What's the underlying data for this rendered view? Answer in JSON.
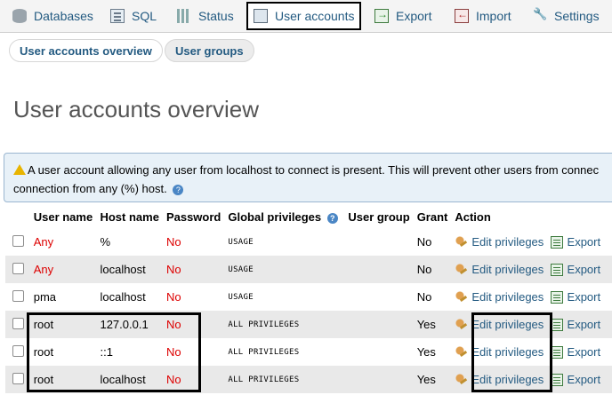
{
  "nav": {
    "tabs": [
      {
        "label": "Databases",
        "icon": "database-icon"
      },
      {
        "label": "SQL",
        "icon": "sql-icon"
      },
      {
        "label": "Status",
        "icon": "status-icon"
      },
      {
        "label": "User accounts",
        "icon": "user-accounts-icon",
        "active": true
      },
      {
        "label": "Export",
        "icon": "export-icon"
      },
      {
        "label": "Import",
        "icon": "import-icon"
      },
      {
        "label": "Settings",
        "icon": "wrench-icon"
      }
    ]
  },
  "subnav": {
    "overview": "User accounts overview",
    "groups": "User groups"
  },
  "page": {
    "title": "User accounts overview"
  },
  "notice": {
    "text": "A user account allowing any user from localhost to connect is present. This will prevent other users from connec",
    "text2": "connection from any (%) host."
  },
  "table": {
    "headers": {
      "user": "User name",
      "host": "Host name",
      "password": "Password",
      "global": "Global privileges",
      "group": "User group",
      "grant": "Grant",
      "action": "Action"
    },
    "edit_label": "Edit privileges",
    "export_label": "Export",
    "rows": [
      {
        "user": "Any",
        "host": "%",
        "password": "No",
        "privileges": "USAGE",
        "grant": "No"
      },
      {
        "user": "Any",
        "host": "localhost",
        "password": "No",
        "privileges": "USAGE",
        "grant": "No"
      },
      {
        "user": "pma",
        "host": "localhost",
        "password": "No",
        "privileges": "USAGE",
        "grant": "No"
      },
      {
        "user": "root",
        "host": "127.0.0.1",
        "password": "No",
        "privileges": "ALL PRIVILEGES",
        "grant": "Yes"
      },
      {
        "user": "root",
        "host": "::1",
        "password": "No",
        "privileges": "ALL PRIVILEGES",
        "grant": "Yes"
      },
      {
        "user": "root",
        "host": "localhost",
        "password": "No",
        "privileges": "ALL PRIVILEGES",
        "grant": "Yes"
      }
    ]
  },
  "colors": {
    "link": "#235a81",
    "red": "#dd0000",
    "notice_bg": "#e8f1f8"
  }
}
